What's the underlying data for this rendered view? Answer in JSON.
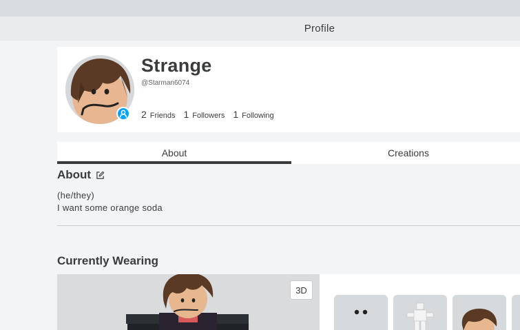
{
  "header": {
    "title": "Profile"
  },
  "profile": {
    "display_name": "Strange",
    "username": "@Starman6074",
    "stats": [
      {
        "count": "2",
        "label": "Friends"
      },
      {
        "count": "1",
        "label": "Followers"
      },
      {
        "count": "1",
        "label": "Following"
      }
    ]
  },
  "tabs": [
    {
      "label": "About",
      "active": true
    },
    {
      "label": "Creations",
      "active": false
    }
  ],
  "about": {
    "heading": "About",
    "bio_lines": [
      "(he/they)",
      "I want some orange soda"
    ]
  },
  "wearing": {
    "heading": "Currently Wearing",
    "view_toggle_label": "3D",
    "items": [
      "face-item",
      "pose-emote-item",
      "hair-item",
      "item-partial"
    ]
  },
  "icons": {
    "edit": "edit-pencil-icon",
    "presence": "online-user-icon"
  },
  "colors": {
    "accent": "#00a2ff",
    "active_tab": "#393b3d",
    "background": "#f2f4f5"
  }
}
